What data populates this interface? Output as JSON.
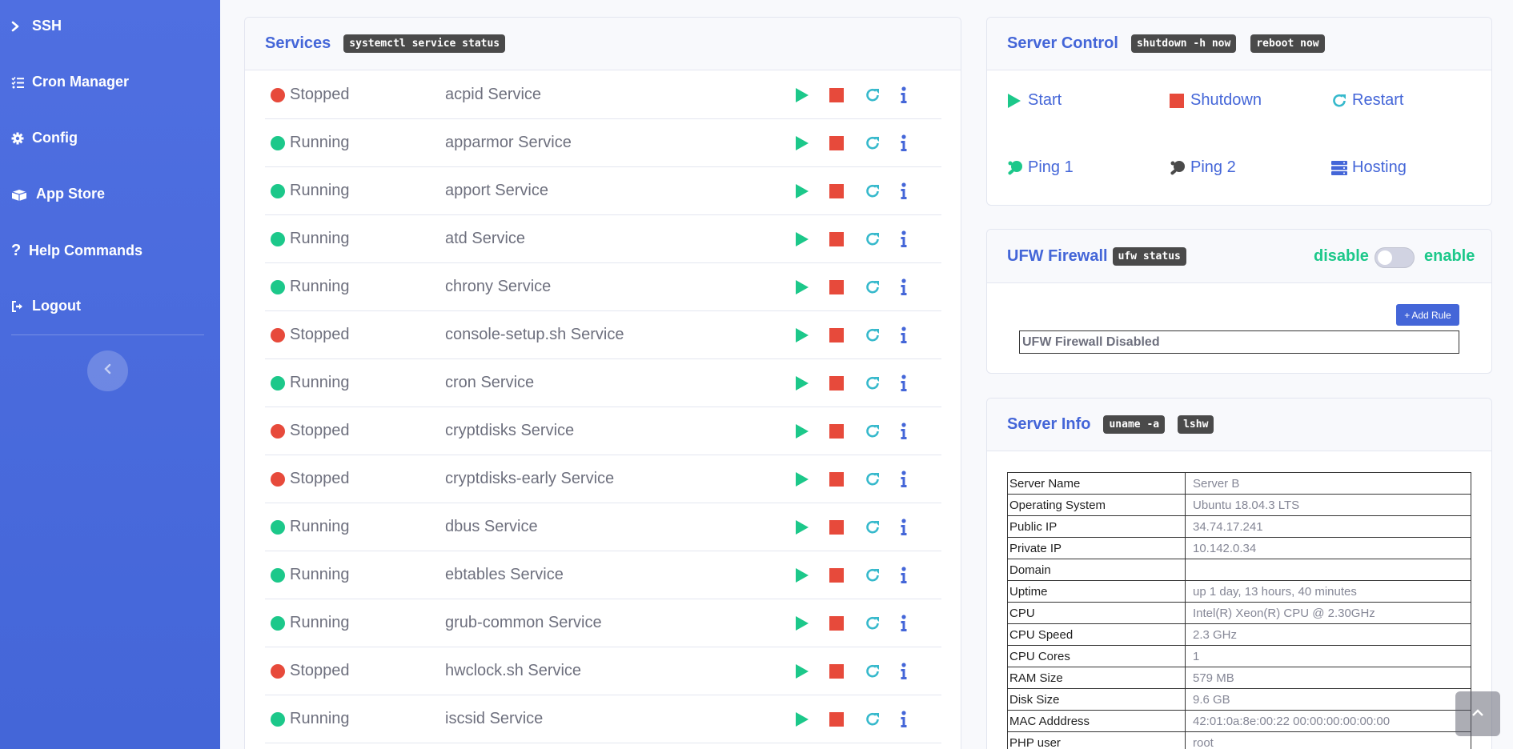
{
  "sidebar": {
    "items": [
      {
        "label": "SSH",
        "icon": "terminal-icon"
      },
      {
        "label": "Cron Manager",
        "icon": "list-check-icon"
      },
      {
        "label": "Config",
        "icon": "gear-icon"
      },
      {
        "label": "App Store",
        "icon": "box-icon"
      },
      {
        "label": "Help Commands",
        "icon": "question-icon"
      },
      {
        "label": "Logout",
        "icon": "sign-out-icon"
      }
    ]
  },
  "services": {
    "title": "Services",
    "command": "systemctl service status",
    "rows": [
      {
        "status": "Stopped",
        "name": "acpid Service"
      },
      {
        "status": "Running",
        "name": "apparmor Service"
      },
      {
        "status": "Running",
        "name": "apport Service"
      },
      {
        "status": "Running",
        "name": "atd Service"
      },
      {
        "status": "Running",
        "name": "chrony Service"
      },
      {
        "status": "Stopped",
        "name": "console-setup.sh Service"
      },
      {
        "status": "Running",
        "name": "cron Service"
      },
      {
        "status": "Stopped",
        "name": "cryptdisks Service"
      },
      {
        "status": "Stopped",
        "name": "cryptdisks-early Service"
      },
      {
        "status": "Running",
        "name": "dbus Service"
      },
      {
        "status": "Running",
        "name": "ebtables Service"
      },
      {
        "status": "Running",
        "name": "grub-common Service"
      },
      {
        "status": "Stopped",
        "name": "hwclock.sh Service"
      },
      {
        "status": "Running",
        "name": "iscsid Service"
      }
    ]
  },
  "server_control": {
    "title": "Server Control",
    "commands": [
      "shutdown -h now",
      "reboot now"
    ],
    "items": [
      {
        "label": "Start",
        "icon": "play-icon"
      },
      {
        "label": "Shutdown",
        "icon": "stop-icon"
      },
      {
        "label": "Restart",
        "icon": "restart-icon"
      },
      {
        "label": "Ping 1",
        "icon": "ping-pong-icon"
      },
      {
        "label": "Ping 2",
        "icon": "ping-pong-icon"
      },
      {
        "label": "Hosting",
        "icon": "server-icon"
      }
    ]
  },
  "ufw": {
    "title": "UFW Firewall",
    "command": "ufw status",
    "disable_label": "disable",
    "enable_label": "enable",
    "add_rule_label": "Add Rule",
    "status_text": "UFW Firewall Disabled"
  },
  "server_info": {
    "title": "Server Info",
    "commands": [
      "uname -a",
      "lshw"
    ],
    "rows": [
      {
        "key": "Server Name",
        "value": "Server B"
      },
      {
        "key": "Operating System",
        "value": "Ubuntu 18.04.3 LTS"
      },
      {
        "key": "Public IP",
        "value": "34.74.17.241"
      },
      {
        "key": "Private IP",
        "value": "10.142.0.34"
      },
      {
        "key": "Domain",
        "value": ""
      },
      {
        "key": "Uptime",
        "value": "up 1 day, 13 hours, 40 minutes"
      },
      {
        "key": "CPU",
        "value": "Intel(R) Xeon(R) CPU @ 2.30GHz"
      },
      {
        "key": "CPU Speed",
        "value": "2.3 GHz"
      },
      {
        "key": "CPU Cores",
        "value": "1"
      },
      {
        "key": "RAM Size",
        "value": "579 MB"
      },
      {
        "key": "Disk Size",
        "value": "9.6 GB"
      },
      {
        "key": "MAC Adddress",
        "value": "42:01:0a:8e:00:22 00:00:00:00:00:00"
      },
      {
        "key": "PHP user",
        "value": "root"
      }
    ]
  },
  "colors": {
    "sidebar": "#4e6fe0",
    "accent": "#4466d8",
    "running": "#1cc88a",
    "stopped": "#e74a3b",
    "restart": "#36b9cc"
  }
}
